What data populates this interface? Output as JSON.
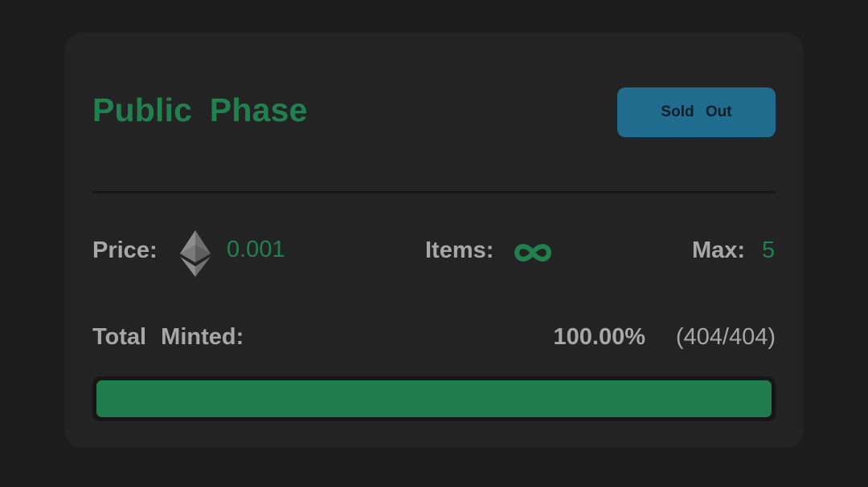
{
  "phase": {
    "title": "Public Phase",
    "status_label": "Sold Out"
  },
  "details": {
    "price_label": "Price:",
    "price_currency_icon": "ethereum-icon",
    "price_value": "0.001",
    "items_label": "Items:",
    "items_icon": "infinity-icon",
    "max_label": "Max:",
    "max_value": "5"
  },
  "minting": {
    "total_minted_label": "Total Minted:",
    "percent_text": "100.00%",
    "count_text": "(404/404)",
    "minted": 404,
    "supply": 404,
    "progress_fraction": 1.0
  },
  "colors": {
    "accent_green": "#22804f",
    "status_blue": "#1f6c8f",
    "background": "#1c1c1c",
    "card": "#232323"
  }
}
